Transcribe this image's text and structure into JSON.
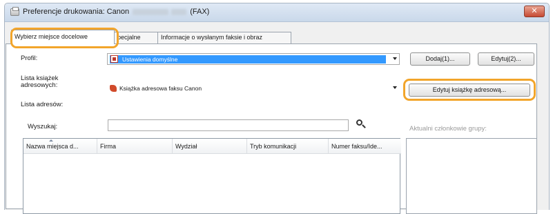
{
  "window": {
    "title_prefix": "Preferencje drukowania: Canon",
    "title_suffix": "(FAX)",
    "close_glyph": "✕"
  },
  "tabs": [
    {
      "label": "Wybierz miejsce docelowe"
    },
    {
      "label": "pecjalne"
    },
    {
      "label": "Informacje o wysłanym faksie i obraz"
    }
  ],
  "profile": {
    "label": "Profil:",
    "value": "Ustawienia domyślne",
    "add_button": "Dodaj(1)...",
    "edit_button": "Edytuj(2)..."
  },
  "address_books": {
    "label_line1": "Lista książek",
    "label_line2": "adresowych:",
    "value": "Książka adresowa faksu Canon",
    "edit_button": "Edytuj książkę adresową..."
  },
  "address_list": {
    "label": "Lista adresów:"
  },
  "search": {
    "label": "Wyszukaj:",
    "value": ""
  },
  "group_members": {
    "label": "Aktualni członkowie grupy:"
  },
  "table": {
    "columns": [
      "Nazwa miejsca d...",
      "Firma",
      "Wydział",
      "Tryb komunikacji",
      "Numer faksu/Ide..."
    ]
  },
  "colors": {
    "highlight": "#f2a52b",
    "selection": "#3399ff",
    "close_button": "#c64a33"
  }
}
